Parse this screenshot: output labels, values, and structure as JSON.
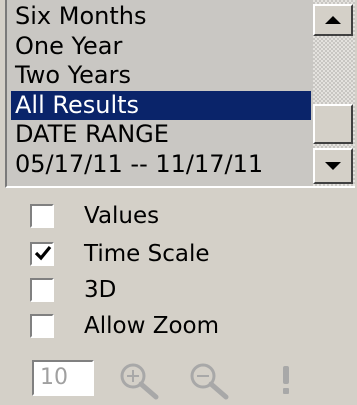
{
  "range_list": {
    "items": [
      {
        "label": "Six Months",
        "selected": false
      },
      {
        "label": "One Year",
        "selected": false
      },
      {
        "label": "Two Years",
        "selected": false
      },
      {
        "label": "All Results",
        "selected": true
      },
      {
        "label": "DATE RANGE",
        "selected": false
      },
      {
        "label": "05/17/11 -- 11/17/11",
        "selected": false
      }
    ]
  },
  "options": [
    {
      "label": "Values",
      "checked": false
    },
    {
      "label": "Time Scale",
      "checked": true
    },
    {
      "label": "3D",
      "checked": false
    },
    {
      "label": "Allow Zoom",
      "checked": false
    }
  ],
  "toolbar": {
    "zoom_value": "10",
    "icons": [
      "zoom-in-icon",
      "zoom-out-icon",
      "exclamation-icon"
    ]
  },
  "colors": {
    "selection": "#0a246a",
    "background": "#d4d0c8"
  }
}
